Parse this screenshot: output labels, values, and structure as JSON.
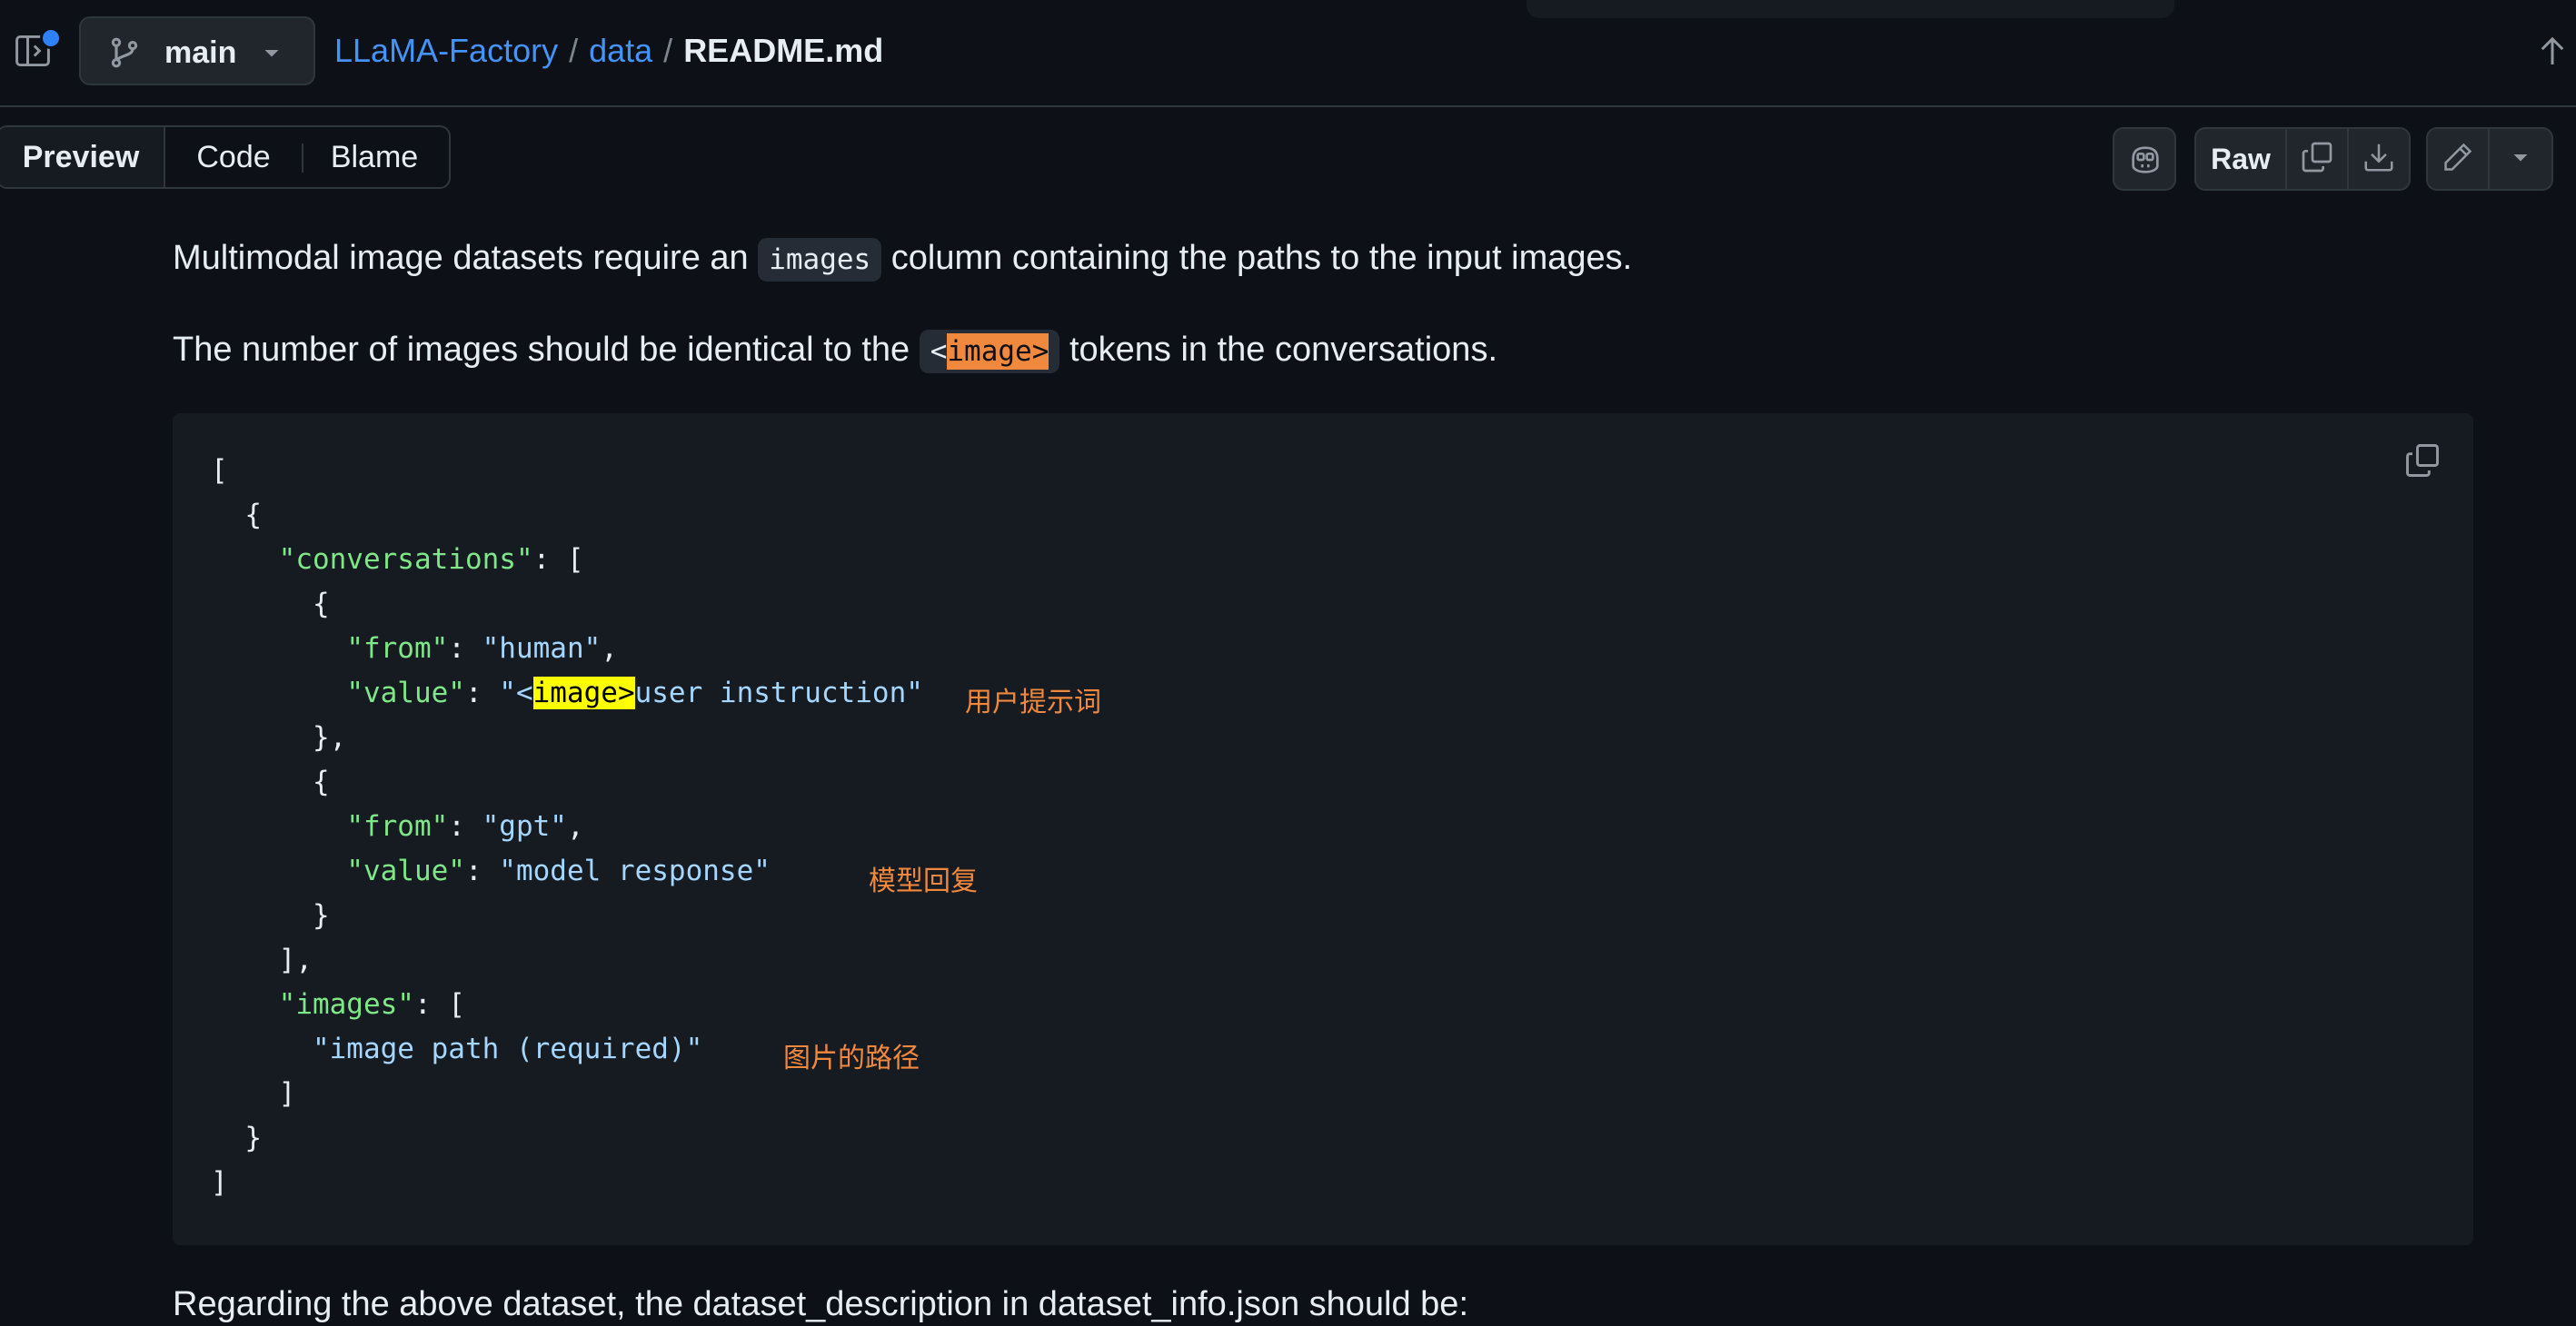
{
  "header": {
    "branch": "main",
    "breadcrumb": {
      "repo": "LLaMA-Factory",
      "folder": "data",
      "file": "README.md",
      "sep": "/"
    }
  },
  "toolbar": {
    "tabs": [
      "Preview",
      "Code",
      "Blame"
    ],
    "raw_label": "Raw"
  },
  "content": {
    "para1": {
      "before": "Multimodal image datasets require an",
      "code": "images",
      "after": "column containing the paths to the input images."
    },
    "para2": {
      "before": "The number of images should be identical to the",
      "code_lt": "<",
      "code_word": "image",
      "code_gt": ">",
      "after": "tokens in the conversations."
    },
    "para3": "Regarding the above dataset, the dataset_description in dataset_info.json should be:",
    "code_lines": {
      "l1": "[",
      "l2": "  {",
      "l3_key": "\"conversations\"",
      "l3_rest": ": [",
      "l4": "      {",
      "l5_key": "\"from\"",
      "l5_colon": ": ",
      "l5_val": "\"human\"",
      "l5_comma": ",",
      "l6_key": "\"value\"",
      "l6_colon": ": ",
      "l6_q": "\"<",
      "l6_hl": "image>",
      "l6_rest": "user instruction\"",
      "l7": "      },",
      "l8": "      {",
      "l9_key": "\"from\"",
      "l9_colon": ": ",
      "l9_val": "\"gpt\"",
      "l9_comma": ",",
      "l10_key": "\"value\"",
      "l10_colon": ": ",
      "l10_val": "\"model response\"",
      "l11": "      }",
      "l12": "    ],",
      "l13_key": "\"images\"",
      "l13_rest": ": [",
      "l14_val": "\"image path (required)\"",
      "l15": "    ]",
      "l16": "  }",
      "l17": "]"
    },
    "notes": {
      "user_prompt": "用户提示词",
      "model_reply": "模型回复",
      "image_path": "图片的路径"
    }
  },
  "icons": {
    "sidebar": "sidebar-toggle-icon",
    "branch": "git-branch-icon",
    "caret": "triangle-down-icon",
    "scroll_top": "arrow-up-icon",
    "copilot": "copilot-icon",
    "copy": "copy-icon",
    "download": "download-icon",
    "edit": "pencil-icon"
  },
  "colors": {
    "background": "#0d1117",
    "link": "#4493f8",
    "json_key": "#7ee787",
    "json_string": "#a5d6ff",
    "annotation": "#f0883e",
    "highlight": "#ffff00"
  }
}
